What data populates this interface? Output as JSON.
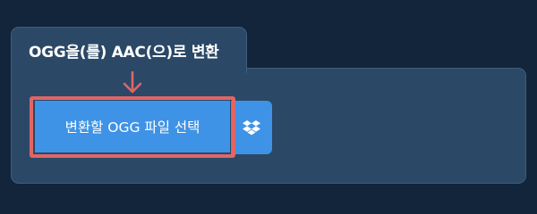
{
  "converter": {
    "title": "OGG을(를) AAC(으)로 변환",
    "select_button_label": "변환할 OGG 파일 선택"
  },
  "icons": {
    "arrow": "arrow-down-icon",
    "dropbox": "dropbox-icon"
  },
  "colors": {
    "page_background": "#12253a",
    "card_background": "#2b4866",
    "button": "#3f93e6",
    "highlight": "#e06666"
  }
}
